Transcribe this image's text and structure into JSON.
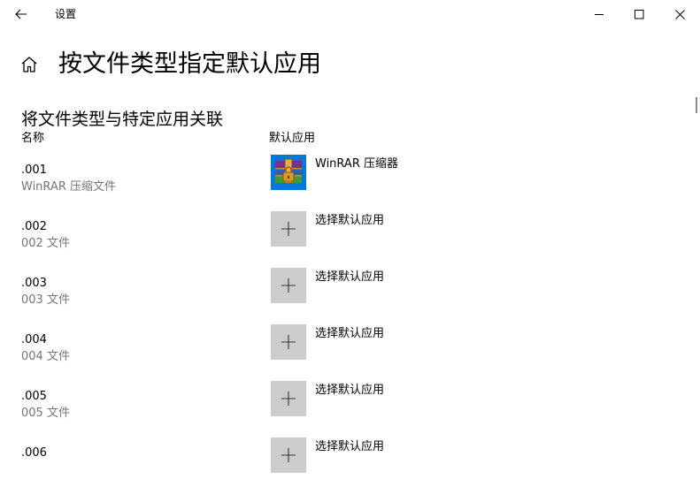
{
  "window": {
    "title": "设置",
    "back_icon": "arrow-left-icon",
    "minimize_icon": "minimize-icon",
    "maximize_icon": "maximize-icon",
    "close_icon": "close-icon"
  },
  "header": {
    "home_icon": "home-icon",
    "title": "按文件类型指定默认应用"
  },
  "section": {
    "title": "将文件类型与特定应用关联",
    "col_name": "名称",
    "col_default_app": "默认应用"
  },
  "rows": [
    {
      "ext": ".001",
      "desc": "WinRAR 压缩文件",
      "app_label": "WinRAR 压缩器",
      "app_icon": "winrar-icon"
    },
    {
      "ext": ".002",
      "desc": "002 文件",
      "app_label": "选择默认应用",
      "app_icon": "plus-icon"
    },
    {
      "ext": ".003",
      "desc": "003 文件",
      "app_label": "选择默认应用",
      "app_icon": "plus-icon"
    },
    {
      "ext": ".004",
      "desc": "004 文件",
      "app_label": "选择默认应用",
      "app_icon": "plus-icon"
    },
    {
      "ext": ".005",
      "desc": "005 文件",
      "app_label": "选择默认应用",
      "app_icon": "plus-icon"
    },
    {
      "ext": ".006",
      "desc": "",
      "app_label": "选择默认应用",
      "app_icon": "plus-icon"
    }
  ],
  "colors": {
    "tile_gray": "#cccccc",
    "secondary_text": "#767676",
    "accent": "#0078d7"
  }
}
